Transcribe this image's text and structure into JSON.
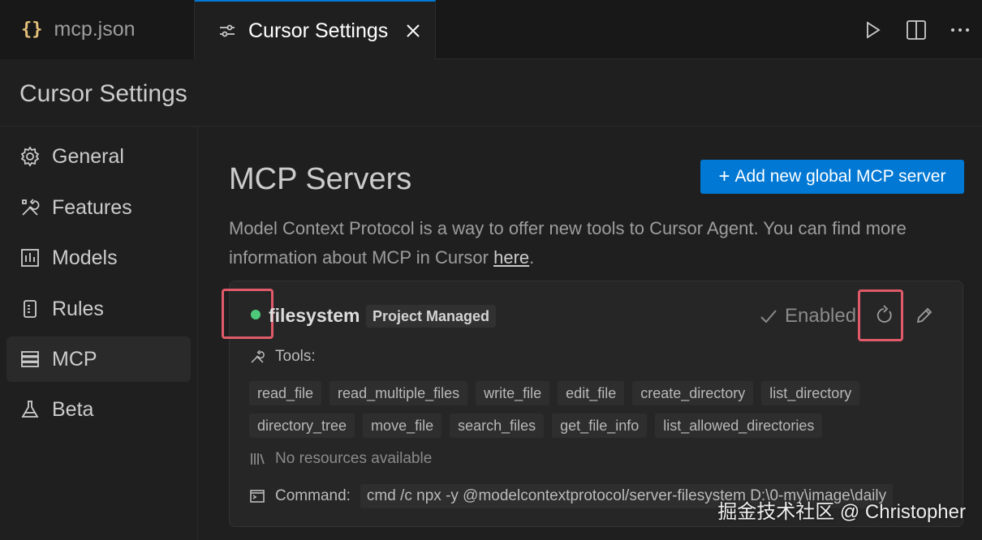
{
  "tabs": [
    {
      "label": "mcp.json",
      "icon": "json-braces-icon",
      "active": false
    },
    {
      "label": "Cursor Settings",
      "icon": "settings-sliders-icon",
      "active": true
    }
  ],
  "tab_actions": [
    "run-icon",
    "split-editor-icon",
    "more-icon"
  ],
  "header": {
    "title": "Cursor Settings"
  },
  "sidebar": {
    "items": [
      {
        "label": "General",
        "icon": "gear-icon"
      },
      {
        "label": "Features",
        "icon": "tools-icon"
      },
      {
        "label": "Models",
        "icon": "models-icon"
      },
      {
        "label": "Rules",
        "icon": "rules-icon"
      },
      {
        "label": "MCP",
        "icon": "mcp-icon",
        "active": true
      },
      {
        "label": "Beta",
        "icon": "flask-icon"
      }
    ]
  },
  "main": {
    "title": "MCP Servers",
    "add_button": {
      "plus": "+",
      "label": "Add new global MCP server"
    },
    "description": "Model Context Protocol is a way to offer new tools to Cursor Agent. You can find more information about MCP in Cursor",
    "description_link": "here",
    "description_end": "."
  },
  "server": {
    "name": "filesystem",
    "badge": "Project Managed",
    "status_color": "#4ec97b",
    "enabled_label": "Enabled",
    "tools_label": "Tools:",
    "tools": [
      "read_file",
      "read_multiple_files",
      "write_file",
      "edit_file",
      "create_directory",
      "list_directory",
      "directory_tree",
      "move_file",
      "search_files",
      "get_file_info",
      "list_allowed_directories"
    ],
    "resources_label": "No resources available",
    "command_label": "Command:",
    "command_value": "cmd /c npx -y @modelcontextprotocol/server-filesystem D:\\0-my\\image\\daily"
  },
  "watermark": "掘金技术社区 @ Christopher",
  "colors": {
    "accent": "#0078d4",
    "highlight": "#e05a6a"
  }
}
